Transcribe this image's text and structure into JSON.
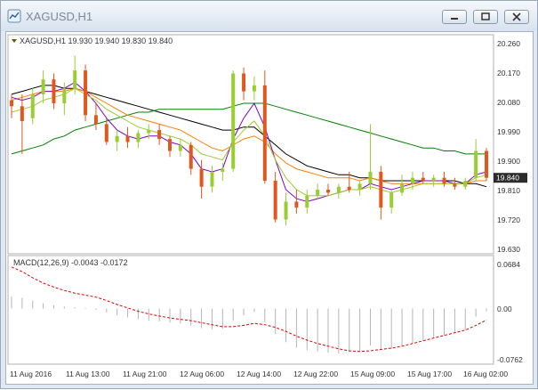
{
  "window": {
    "title": "XAGUSD,H1"
  },
  "chart_data": [
    {
      "type": "candlestick",
      "title": "XAGUSD,H1",
      "header_text": "XAGUSD,H1  19.930 19.940 19.830 19.840",
      "ohlc_current": {
        "open": "19.930",
        "high": "19.940",
        "low": "19.830",
        "close": "19.840"
      },
      "current_price_label": "19.840",
      "ylim": [
        19.6,
        20.29
      ],
      "yticks": [
        "20.260",
        "20.170",
        "20.080",
        "19.990",
        "19.900",
        "19.810",
        "19.720",
        "19.630"
      ],
      "xticks": [
        "11 Aug 2016",
        "11 Aug 13:00",
        "11 Aug 21:00",
        "12 Aug 06:00",
        "12 Aug 14:00",
        "12 Aug 22:00",
        "15 Aug 09:00",
        "15 Aug 17:00",
        "16 Aug 02:00"
      ],
      "candles": [
        [
          20.1,
          20.12,
          20.04,
          20.08
        ],
        [
          20.08,
          20.12,
          19.92,
          20.03
        ],
        [
          20.04,
          20.14,
          20.02,
          20.12
        ],
        [
          20.12,
          20.2,
          20.09,
          20.17
        ],
        [
          20.17,
          20.19,
          20.07,
          20.09
        ],
        [
          20.09,
          20.16,
          20.05,
          20.14
        ],
        [
          20.14,
          20.25,
          20.12,
          20.2
        ],
        [
          20.2,
          20.22,
          20.03,
          20.05
        ],
        [
          20.05,
          20.09,
          20.0,
          20.02
        ],
        [
          20.02,
          20.04,
          19.95,
          19.96
        ],
        [
          19.96,
          20.0,
          19.93,
          19.98
        ],
        [
          19.98,
          20.01,
          19.94,
          19.96
        ],
        [
          19.96,
          20.0,
          19.94,
          19.99
        ],
        [
          19.99,
          20.02,
          19.97,
          20.0
        ],
        [
          20.0,
          20.02,
          19.95,
          19.97
        ],
        [
          19.97,
          19.98,
          19.91,
          19.93
        ],
        [
          19.93,
          19.97,
          19.91,
          19.95
        ],
        [
          19.95,
          19.96,
          19.85,
          19.87
        ],
        [
          19.87,
          19.9,
          19.77,
          19.81
        ],
        [
          19.81,
          19.88,
          19.79,
          19.86
        ],
        [
          19.86,
          19.89,
          19.83,
          19.87
        ],
        [
          19.87,
          20.2,
          19.86,
          20.19
        ],
        [
          20.19,
          20.21,
          20.1,
          20.13
        ],
        [
          20.13,
          20.18,
          20.1,
          20.15
        ],
        [
          20.15,
          20.2,
          19.82,
          19.83
        ],
        [
          19.83,
          19.86,
          19.69,
          19.7
        ],
        [
          19.7,
          19.79,
          19.68,
          19.76
        ],
        [
          19.76,
          19.8,
          19.72,
          19.74
        ],
        [
          19.74,
          19.8,
          19.72,
          19.78
        ],
        [
          19.78,
          19.82,
          19.77,
          19.8
        ],
        [
          19.8,
          19.82,
          19.78,
          19.79
        ],
        [
          19.79,
          19.82,
          19.77,
          19.81
        ],
        [
          19.81,
          19.86,
          19.79,
          19.8
        ],
        [
          19.8,
          19.83,
          19.78,
          19.82
        ],
        [
          19.82,
          20.02,
          19.8,
          19.86
        ],
        [
          19.86,
          19.88,
          19.7,
          19.74
        ],
        [
          19.74,
          19.8,
          19.72,
          19.79
        ],
        [
          19.79,
          19.85,
          19.78,
          19.82
        ],
        [
          19.82,
          19.86,
          19.8,
          19.84
        ],
        [
          19.84,
          19.86,
          19.82,
          19.83
        ],
        [
          19.83,
          19.85,
          19.81,
          19.84
        ],
        [
          19.84,
          19.86,
          19.81,
          19.82
        ],
        [
          19.82,
          19.84,
          19.8,
          19.81
        ],
        [
          19.81,
          19.84,
          19.8,
          19.83
        ],
        [
          19.84,
          19.97,
          19.83,
          19.93
        ],
        [
          19.93,
          19.94,
          19.83,
          19.84
        ]
      ],
      "moving_averages": [
        {
          "color": "#000000",
          "values": [
            20.12,
            20.13,
            20.14,
            20.15,
            20.15,
            20.14,
            20.14,
            20.13,
            20.12,
            20.11,
            20.1,
            20.09,
            20.08,
            20.07,
            20.06,
            20.05,
            20.04,
            20.03,
            20.02,
            20.01,
            20.0,
            20.0,
            20.01,
            20.01,
            19.98,
            19.95,
            19.92,
            19.9,
            19.88,
            19.87,
            19.86,
            19.85,
            19.85,
            19.84,
            19.84,
            19.83,
            19.83,
            19.83,
            19.83,
            19.83,
            19.83,
            19.83,
            19.83,
            19.82,
            19.82,
            19.81
          ]
        },
        {
          "color": "#008000",
          "values": [
            19.92,
            19.93,
            19.94,
            19.95,
            19.97,
            19.98,
            20.0,
            20.01,
            20.02,
            20.03,
            20.04,
            20.05,
            20.06,
            20.06,
            20.07,
            20.07,
            20.07,
            20.07,
            20.07,
            20.07,
            20.07,
            20.08,
            20.09,
            20.09,
            20.09,
            20.08,
            20.07,
            20.06,
            20.05,
            20.04,
            20.03,
            20.02,
            20.01,
            20.0,
            19.99,
            19.98,
            19.97,
            19.96,
            19.95,
            19.94,
            19.94,
            19.93,
            19.93,
            19.92,
            19.92,
            19.92
          ]
        },
        {
          "color": "#ff7f00",
          "values": [
            20.1,
            20.11,
            20.12,
            20.13,
            20.13,
            20.13,
            20.14,
            20.13,
            20.11,
            20.09,
            20.07,
            20.05,
            20.04,
            20.03,
            20.02,
            20.01,
            20.0,
            19.98,
            19.96,
            19.94,
            19.93,
            19.95,
            19.97,
            19.98,
            19.96,
            19.92,
            19.89,
            19.87,
            19.86,
            19.85,
            19.84,
            19.84,
            19.84,
            19.83,
            19.84,
            19.83,
            19.82,
            19.82,
            19.82,
            19.82,
            19.82,
            19.82,
            19.82,
            19.82,
            19.83,
            19.83
          ]
        },
        {
          "color": "#8000c0",
          "values": [
            20.11,
            20.1,
            20.11,
            20.13,
            20.13,
            20.14,
            20.16,
            20.13,
            20.09,
            20.04,
            20.0,
            19.98,
            19.97,
            19.98,
            19.98,
            19.96,
            19.95,
            19.92,
            19.87,
            19.86,
            19.87,
            19.97,
            20.04,
            20.09,
            20.01,
            19.9,
            19.8,
            19.77,
            19.76,
            19.77,
            19.78,
            19.79,
            19.8,
            19.8,
            19.82,
            19.81,
            19.8,
            19.81,
            19.82,
            19.83,
            19.83,
            19.83,
            19.82,
            19.82,
            19.85,
            19.86
          ]
        },
        {
          "color": "#9acd32",
          "values": [
            20.06,
            20.07,
            20.08,
            20.1,
            20.11,
            20.12,
            20.14,
            20.12,
            20.1,
            20.07,
            20.05,
            20.03,
            20.01,
            20.0,
            19.99,
            19.98,
            19.97,
            19.95,
            19.92,
            19.91,
            19.9,
            19.96,
            20.0,
            20.03,
            19.98,
            19.9,
            19.84,
            19.8,
            19.78,
            19.78,
            19.78,
            19.79,
            19.8,
            19.8,
            19.81,
            19.8,
            19.79,
            19.8,
            19.81,
            19.82,
            19.82,
            19.82,
            19.82,
            19.82,
            19.84,
            19.85
          ]
        }
      ]
    },
    {
      "type": "macd",
      "label": "MACD(12,26,9) -0.0043 -0.0172",
      "ylim": [
        -0.0762,
        0.0684
      ],
      "yticks": [
        "0.0684",
        "0.00",
        "-0.0762"
      ],
      "histogram": [
        0.018,
        0.016,
        0.012,
        0.008,
        0.005,
        0.003,
        0.002,
        0.001,
        -0.002,
        -0.006,
        -0.01,
        -0.013,
        -0.016,
        -0.018,
        -0.019,
        -0.021,
        -0.022,
        -0.025,
        -0.029,
        -0.031,
        -0.03,
        -0.018,
        -0.01,
        -0.005,
        -0.02,
        -0.038,
        -0.05,
        -0.058,
        -0.062,
        -0.064,
        -0.066,
        -0.067,
        -0.065,
        -0.064,
        -0.055,
        -0.06,
        -0.06,
        -0.056,
        -0.052,
        -0.048,
        -0.044,
        -0.04,
        -0.036,
        -0.032,
        -0.012,
        -0.004
      ],
      "signal": [
        0.062,
        0.055,
        0.046,
        0.038,
        0.032,
        0.027,
        0.023,
        0.02,
        0.017,
        0.012,
        0.006,
        0.001,
        -0.004,
        -0.008,
        -0.011,
        -0.014,
        -0.016,
        -0.018,
        -0.021,
        -0.024,
        -0.027,
        -0.027,
        -0.025,
        -0.022,
        -0.024,
        -0.028,
        -0.034,
        -0.041,
        -0.047,
        -0.052,
        -0.056,
        -0.06,
        -0.063,
        -0.064,
        -0.063,
        -0.061,
        -0.059,
        -0.056,
        -0.052,
        -0.048,
        -0.044,
        -0.04,
        -0.036,
        -0.032,
        -0.025,
        -0.017
      ]
    }
  ]
}
